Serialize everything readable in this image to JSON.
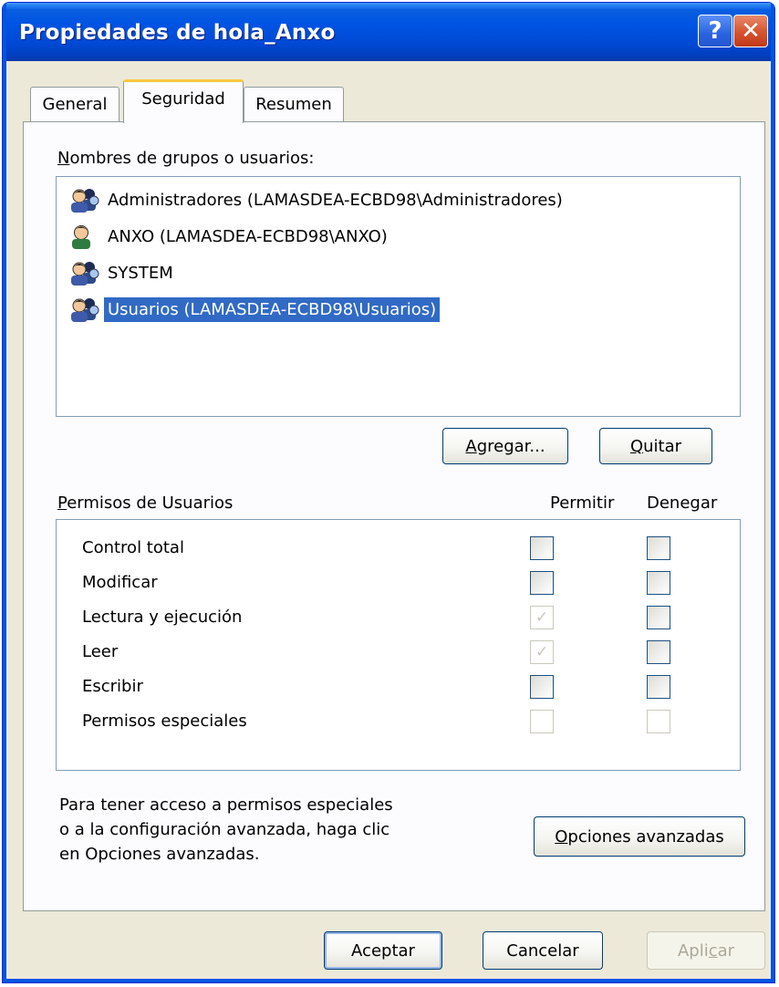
{
  "window": {
    "title": "Propiedades de hola_Anxo",
    "help_glyph": "?",
    "close_glyph": "✕"
  },
  "tabs": [
    {
      "label": "General",
      "active": false
    },
    {
      "label": "Seguridad",
      "active": true
    },
    {
      "label": "Resumen",
      "active": false
    }
  ],
  "groups": {
    "label_accel": "N",
    "label_rest": "ombres de grupos o usuarios:",
    "items": [
      {
        "name": "Administradores (LAMASDEA-ECBD98\\Administradores)",
        "icon": "group-users-icon",
        "selected": false
      },
      {
        "name": "ANXO (LAMASDEA-ECBD98\\ANXO)",
        "icon": "user-icon",
        "selected": false
      },
      {
        "name": "SYSTEM",
        "icon": "group-users-icon",
        "selected": false
      },
      {
        "name": "Usuarios (LAMASDEA-ECBD98\\Usuarios)",
        "icon": "group-users-icon",
        "selected": true
      }
    ],
    "add_accel": "A",
    "add_rest": "gregar...",
    "remove_accel": "Q",
    "remove_rest": "uitar"
  },
  "permissions": {
    "label_accel": "P",
    "label_rest": "ermisos de Usuarios",
    "col_allow": "Permitir",
    "col_deny": "Denegar",
    "rows": [
      {
        "label": "Control total",
        "allow": false,
        "allow_disabled": false,
        "deny": false,
        "deny_disabled": false
      },
      {
        "label": "Modificar",
        "allow": false,
        "allow_disabled": false,
        "deny": false,
        "deny_disabled": false
      },
      {
        "label": "Lectura y ejecución",
        "allow": true,
        "allow_disabled": true,
        "deny": false,
        "deny_disabled": false
      },
      {
        "label": "Leer",
        "allow": true,
        "allow_disabled": true,
        "deny": false,
        "deny_disabled": false
      },
      {
        "label": "Escribir",
        "allow": false,
        "allow_disabled": false,
        "deny": false,
        "deny_disabled": false
      },
      {
        "label": "Permisos especiales",
        "allow": false,
        "allow_disabled": true,
        "deny": false,
        "deny_disabled": true
      }
    ]
  },
  "advanced": {
    "line1": "Para tener acceso a permisos especiales",
    "line2": "o a la configuración avanzada, haga clic",
    "line3": "en Opciones avanzadas.",
    "button_accel": "O",
    "button_rest": "pciones avanzadas"
  },
  "footer": {
    "ok": "Aceptar",
    "cancel": "Cancelar",
    "apply_pre": "Apli",
    "apply_accel": "c",
    "apply_post": "ar"
  },
  "colors": {
    "titlebar": "#0054e3",
    "selection": "#316ac5",
    "dialog_bg": "#ece9d8",
    "tab_highlight": "#ffc83c"
  }
}
